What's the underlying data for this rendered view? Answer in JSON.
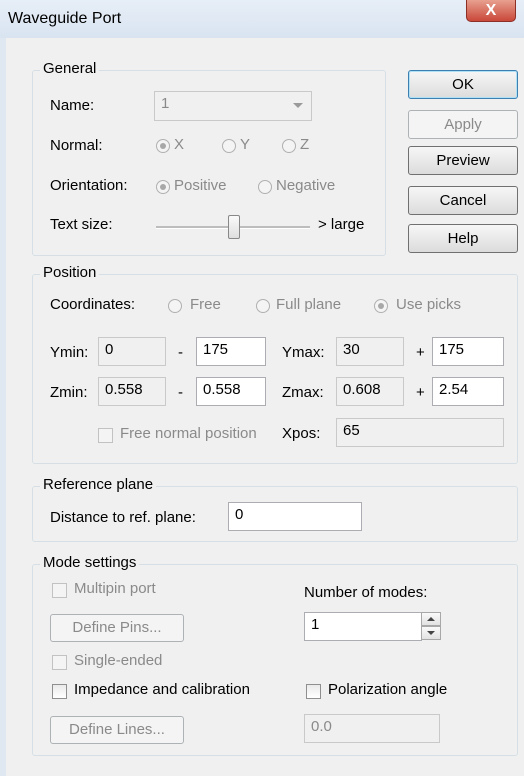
{
  "window": {
    "title": "Waveguide Port",
    "close_glyph": "X"
  },
  "general": {
    "legend": "General",
    "name_label": "Name:",
    "name_value": "1",
    "normal_label": "Normal:",
    "normal_options": [
      "X",
      "Y",
      "Z"
    ],
    "normal_selected": "X",
    "orientation_label": "Orientation:",
    "orientation_options": [
      "Positive",
      "Negative"
    ],
    "orientation_selected": "Positive",
    "textsize_label": "Text size:",
    "textsize_max_label": "> large",
    "textsize_level": 0.55
  },
  "buttons": {
    "ok": "OK",
    "apply": "Apply",
    "preview": "Preview",
    "cancel": "Cancel",
    "help": "Help"
  },
  "position": {
    "legend": "Position",
    "coordinates_label": "Coordinates:",
    "coordinate_options": [
      "Free",
      "Full plane",
      "Use picks"
    ],
    "coordinate_selected": "Use picks",
    "ymin_label": "Ymin:",
    "ymin": "0",
    "ymin_minus": "175",
    "ymax_label": "Ymax:",
    "ymax": "30",
    "ymax_plus": "175",
    "zmin_label": "Zmin:",
    "zmin": "0.558",
    "zmin_minus": "0.558",
    "zmax_label": "Zmax:",
    "zmax": "0.608",
    "zmax_plus": "2.54",
    "minus_sign": "-",
    "plus_sign": "+",
    "free_normal_label": "Free normal position",
    "xpos_label": "Xpos:",
    "xpos": "65"
  },
  "reference": {
    "legend": "Reference plane",
    "distance_label": "Distance to ref. plane:",
    "distance": "0"
  },
  "mode": {
    "legend": "Mode settings",
    "multipin_label": "Multipin port",
    "num_modes_label": "Number of modes:",
    "num_modes": "1",
    "define_pins": "Define Pins...",
    "single_ended_label": "Single-ended",
    "impedance_label": "Impedance and calibration",
    "polarization_label": "Polarization angle",
    "define_lines": "Define Lines...",
    "polarization_value": "0.0"
  }
}
